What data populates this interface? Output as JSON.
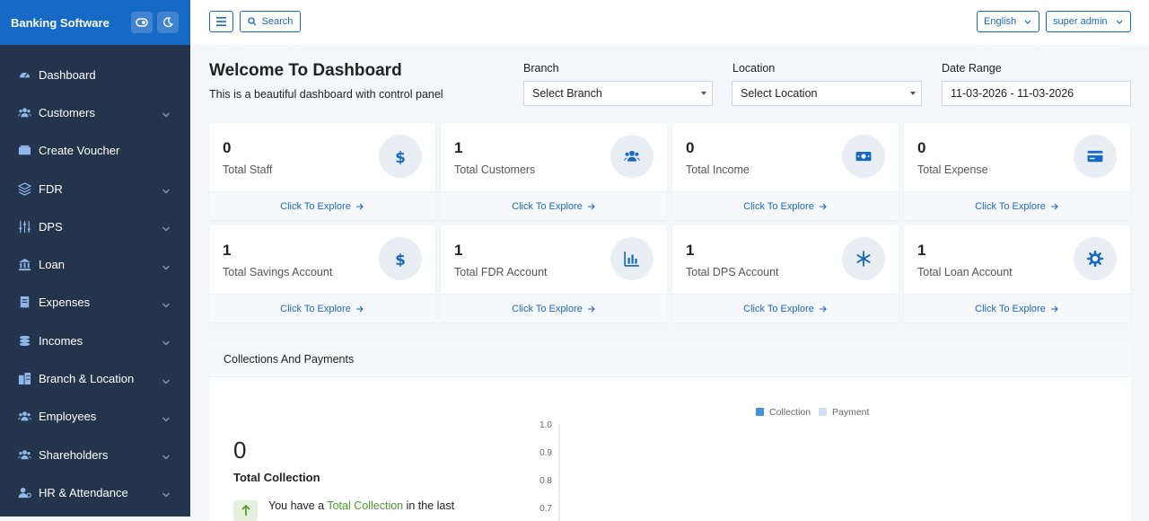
{
  "brand": {
    "title": "Banking Software"
  },
  "sidebar": {
    "items": [
      {
        "label": "Dashboard",
        "icon": "dashboard-icon",
        "has_submenu": false
      },
      {
        "label": "Customers",
        "icon": "users-icon",
        "has_submenu": true
      },
      {
        "label": "Create Voucher",
        "icon": "voucher-icon",
        "has_submenu": false
      },
      {
        "label": "FDR",
        "icon": "layers-icon",
        "has_submenu": true
      },
      {
        "label": "DPS",
        "icon": "sliders-icon",
        "has_submenu": true
      },
      {
        "label": "Loan",
        "icon": "bank-icon",
        "has_submenu": true
      },
      {
        "label": "Expenses",
        "icon": "receipt-icon",
        "has_submenu": true
      },
      {
        "label": "Incomes",
        "icon": "coins-icon",
        "has_submenu": true
      },
      {
        "label": "Branch & Location",
        "icon": "building-icon",
        "has_submenu": true
      },
      {
        "label": "Employees",
        "icon": "users-icon",
        "has_submenu": true
      },
      {
        "label": "Shareholders",
        "icon": "users-icon",
        "has_submenu": true
      },
      {
        "label": "HR & Attendance",
        "icon": "user-gear-icon",
        "has_submenu": true
      }
    ]
  },
  "topbar": {
    "search_label": "Search",
    "language": "English",
    "user": "super admin"
  },
  "header": {
    "title": "Welcome To Dashboard",
    "subtitle": "This is a beautiful dashboard with control panel"
  },
  "filters": {
    "branch_label": "Branch",
    "branch_value": "Select Branch",
    "location_label": "Location",
    "location_value": "Select Location",
    "date_label": "Date Range",
    "date_value": "11-03-2026 - 11-03-2026"
  },
  "cards": [
    {
      "value": "0",
      "label": "Total Staff",
      "icon": "dollar-icon",
      "explore": "Click To Explore"
    },
    {
      "value": "1",
      "label": "Total Customers",
      "icon": "users-icon",
      "explore": "Click To Explore"
    },
    {
      "value": "0",
      "label": "Total Income",
      "icon": "money-bill-icon",
      "explore": "Click To Explore"
    },
    {
      "value": "0",
      "label": "Total Expense",
      "icon": "credit-card-icon",
      "explore": "Click To Explore"
    },
    {
      "value": "1",
      "label": "Total Savings Account",
      "icon": "dollar-icon",
      "explore": "Click To Explore"
    },
    {
      "value": "1",
      "label": "Total FDR Account",
      "icon": "bar-chart-icon",
      "explore": "Click To Explore"
    },
    {
      "value": "1",
      "label": "Total DPS Account",
      "icon": "snowflake-icon",
      "explore": "Click To Explore"
    },
    {
      "value": "1",
      "label": "Total Loan Account",
      "icon": "gear-icon",
      "explore": "Click To Explore"
    }
  ],
  "collections": {
    "title": "Collections And Payments",
    "total_value": "0",
    "total_label": "Total Collection",
    "note_prefix": "You have a ",
    "note_highlight": "Total Collection",
    "note_suffix": " in the last"
  },
  "chart_data": {
    "type": "bar",
    "series": [
      {
        "name": "Collection",
        "values": []
      },
      {
        "name": "Payment",
        "values": []
      }
    ],
    "yticks": [
      "1.0",
      "0.9",
      "0.8",
      "0.7"
    ],
    "legend": "top-center",
    "colors": {
      "Collection": "#4a8fdc",
      "Payment": "#cfe0f5"
    }
  },
  "colors": {
    "accent": "#1769c6",
    "sidebar": "#24344d",
    "highlight_green": "#4a9a2c"
  }
}
